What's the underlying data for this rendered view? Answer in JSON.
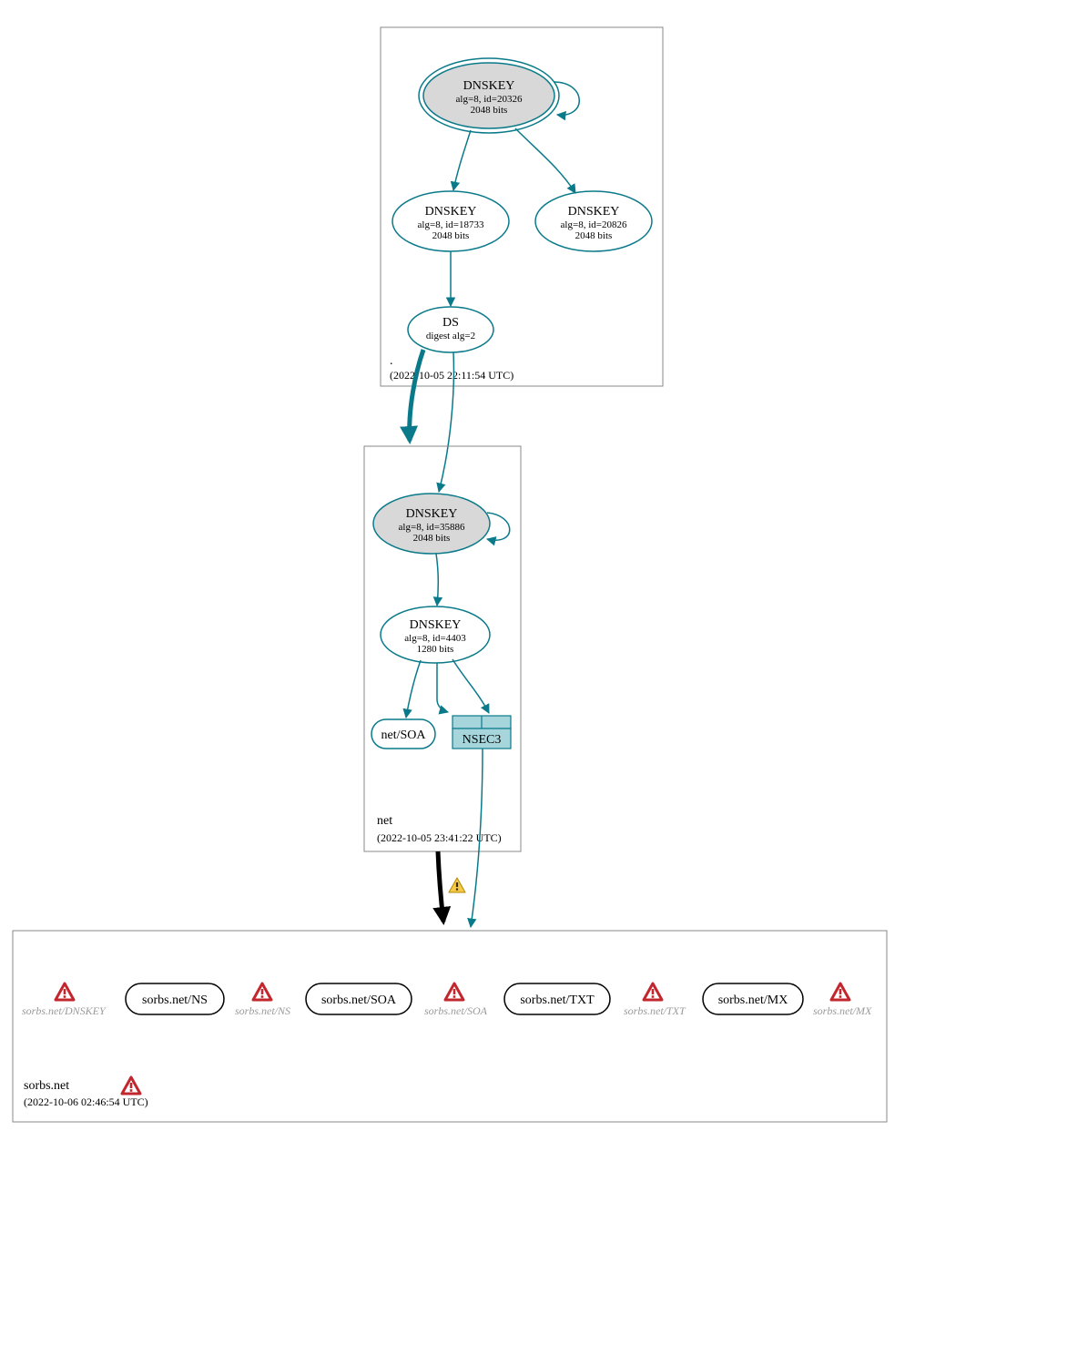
{
  "colors": {
    "teal": "#0a7a8a",
    "gray_fill": "#d8d8d8",
    "warn_red": "#c1272d",
    "warn_yellow": "#f7c948",
    "warn_text": "#9a9a9a"
  },
  "zones": {
    "root": {
      "label": ".",
      "timestamp": "(2022-10-05 22:11:54 UTC)",
      "nodes": {
        "ksk": {
          "title": "DNSKEY",
          "line2": "alg=8, id=20326",
          "line3": "2048 bits"
        },
        "zsk1": {
          "title": "DNSKEY",
          "line2": "alg=8, id=18733",
          "line3": "2048 bits"
        },
        "zsk2": {
          "title": "DNSKEY",
          "line2": "alg=8, id=20826",
          "line3": "2048 bits"
        },
        "ds": {
          "title": "DS",
          "line2": "digest alg=2"
        }
      }
    },
    "net": {
      "label": "net",
      "timestamp": "(2022-10-05 23:41:22 UTC)",
      "nodes": {
        "ksk": {
          "title": "DNSKEY",
          "line2": "alg=8, id=35886",
          "line3": "2048 bits"
        },
        "zsk": {
          "title": "DNSKEY",
          "line2": "alg=8, id=4403",
          "line3": "1280 bits"
        },
        "soa": {
          "title": "net/SOA"
        },
        "nsec3": {
          "title": "NSEC3"
        }
      }
    },
    "sorbs": {
      "label": "sorbs.net",
      "timestamp": "(2022-10-06 02:46:54 UTC)",
      "warn_items": [
        "sorbs.net/DNSKEY",
        "sorbs.net/NS",
        "sorbs.net/SOA",
        "sorbs.net/TXT",
        "sorbs.net/MX"
      ],
      "records": [
        "sorbs.net/NS",
        "sorbs.net/SOA",
        "sorbs.net/TXT",
        "sorbs.net/MX"
      ]
    }
  }
}
